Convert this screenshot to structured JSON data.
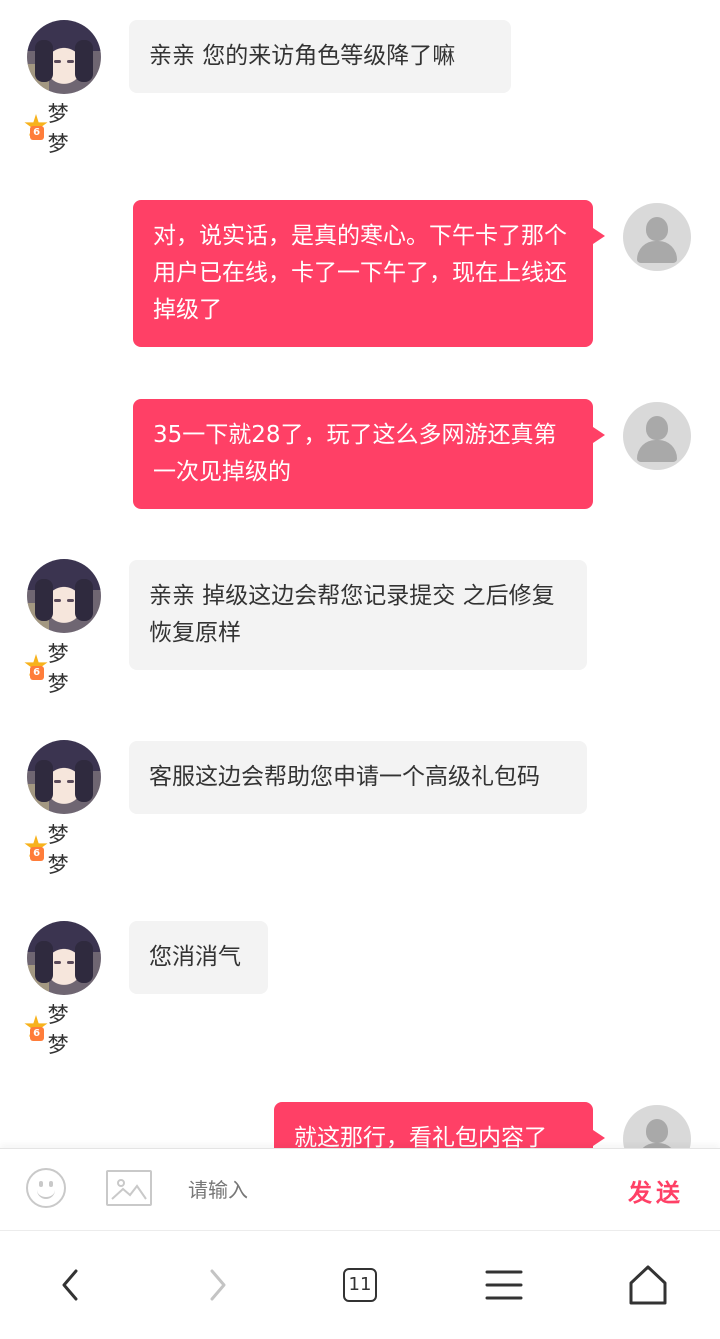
{
  "messages": [
    {
      "side": "in",
      "text": "亲亲 您的来访角色等级降了嘛",
      "sender": "梦梦",
      "level": "6"
    },
    {
      "side": "out",
      "text": "对，说实话，是真的寒心。下午卡了那个用户已在线，卡了一下午了，现在上线还掉级了"
    },
    {
      "side": "out",
      "text": "35一下就28了，玩了这么多网游还真第一次见掉级的"
    },
    {
      "side": "in",
      "text": "亲亲 掉级这边会帮您记录提交 之后修复恢复原样",
      "sender": "梦梦",
      "level": "6"
    },
    {
      "side": "in",
      "text": "客服这边会帮助您申请一个高级礼包码",
      "sender": "梦梦",
      "level": "6"
    },
    {
      "side": "in",
      "text": "您消消气",
      "sender": "梦梦",
      "level": "6"
    },
    {
      "side": "out",
      "text": "就这那行，看礼包内容了"
    }
  ],
  "input": {
    "placeholder": "请输入",
    "value": "",
    "send_label": "发送",
    "emoji_icon": "smiley-icon",
    "image_icon": "image-icon"
  },
  "nav": {
    "tab_count": "11",
    "icons": [
      "back-arrow-icon",
      "forward-arrow-icon",
      "tabs-icon",
      "menu-icon",
      "home-icon"
    ]
  },
  "colors": {
    "outgoing_bubble": "#ff4066",
    "incoming_bubble": "#f3f3f3",
    "send_text": "#ff4066",
    "badge_star": "#f7b21c"
  }
}
